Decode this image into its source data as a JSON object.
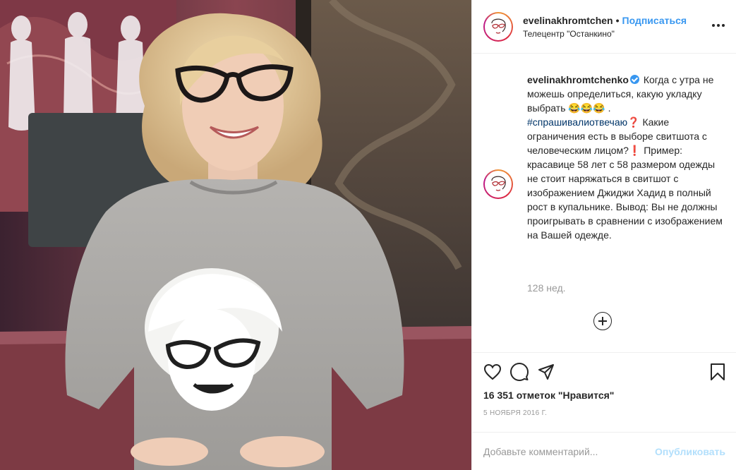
{
  "post": {
    "image_alt": "Фото: женщина в очках и сером свитшоте с изображением лица"
  },
  "header": {
    "username": "evelinakhromtchen",
    "separator": "•",
    "follow_label": "Подписаться",
    "location": "Телецентр \"Останкино\"",
    "more_icon": "more-horizontal-icon"
  },
  "caption": {
    "username": "evelinakhromtchenko",
    "verified_icon": "verified-badge-icon",
    "text_part1": " Когда с утра не можешь определиться, какую укладку выбрать 😂😂😂 . ",
    "hashtag": "#спрашивалиотвечаю",
    "text_part2": "❓ Какие ограничения есть в выборе свитшота с человеческим лицом?❗ Пример: красавице 58 лет с 58 размером одежды не стоит наряжаться в свитшот с изображением Джиджи Хадид в полный рост в купальнике. Вывод: Вы не должны проигрывать в сравнении с изображением на Вашей одежде.",
    "time_ago": "128 нед."
  },
  "actions": {
    "like_icon": "heart-icon",
    "comment_icon": "comment-bubble-icon",
    "share_icon": "paper-plane-icon",
    "save_icon": "bookmark-icon",
    "load_more_icon": "plus-circle-icon",
    "likes_text": "16 351 отметок \"Нравится\"",
    "date": "5 НОЯБРЯ 2016 Г."
  },
  "comment_box": {
    "placeholder": "Добавьте комментарий...",
    "publish_label": "Опубликовать"
  },
  "colors": {
    "accent": "#3897f0",
    "publish_disabled": "#b2dffc",
    "muted": "#999999",
    "text": "#262626"
  }
}
